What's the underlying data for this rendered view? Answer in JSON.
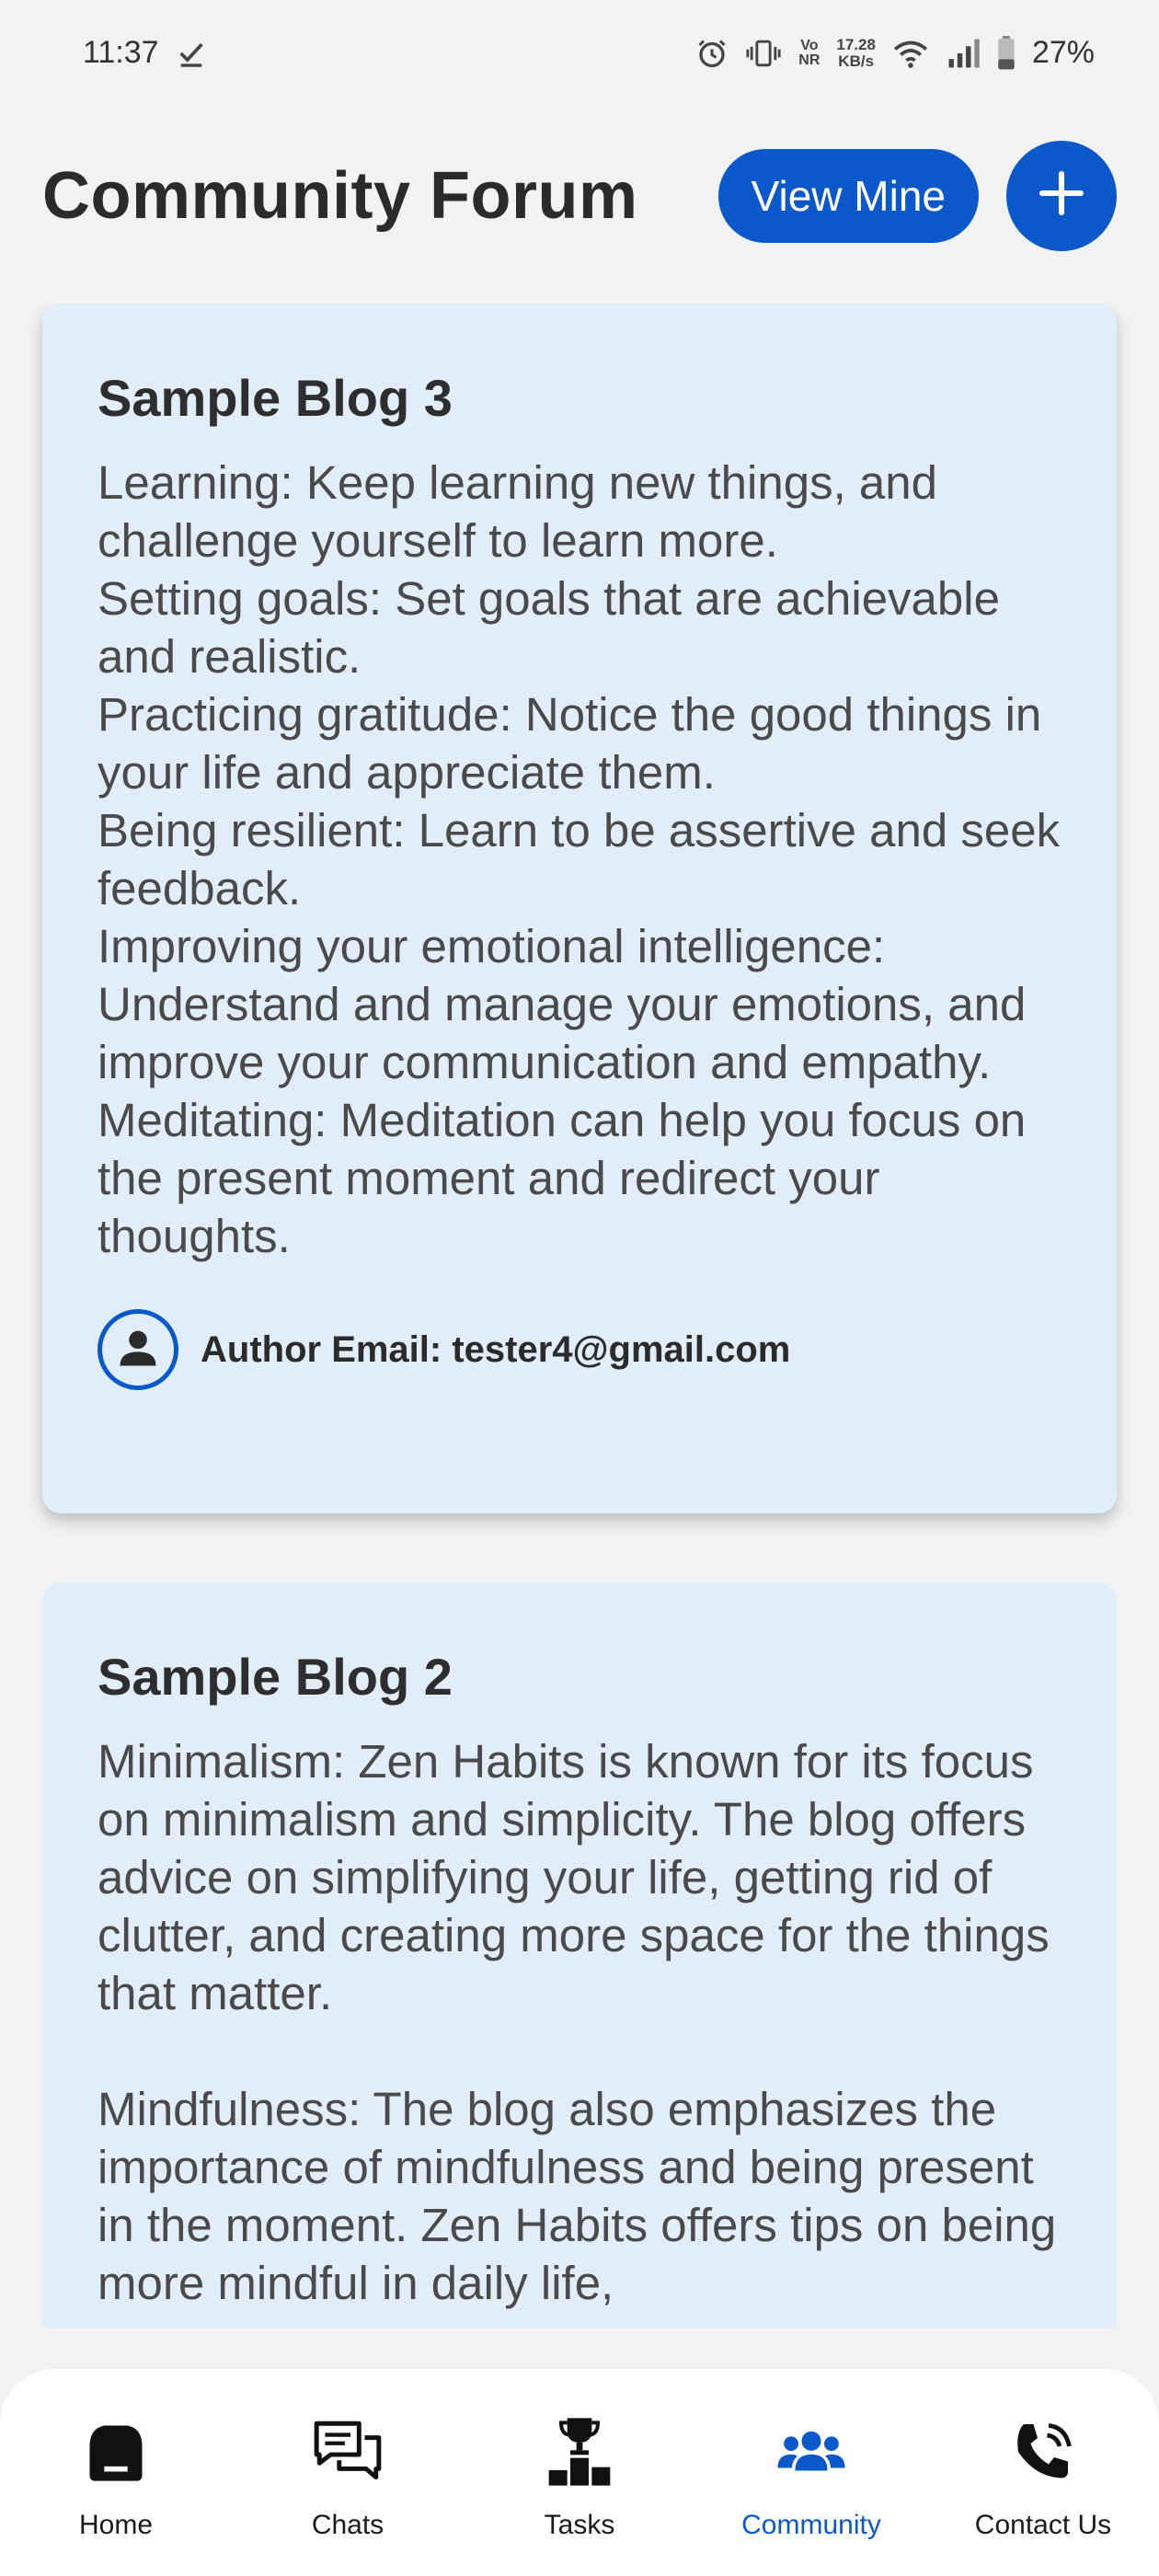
{
  "status_bar": {
    "time": "11:37",
    "network_top": "Vo",
    "network_bottom": "NR",
    "speed_top": "17.28",
    "speed_bottom": "KB/s",
    "battery": "27%"
  },
  "header": {
    "title": "Community Forum",
    "view_mine_label": "View Mine"
  },
  "posts": [
    {
      "title": "Sample Blog 3",
      "body": "Learning: Keep learning new things, and challenge yourself to learn more.\nSetting goals: Set goals that are achievable and realistic.\nPracticing gratitude: Notice the good things in your life and appreciate them.\nBeing resilient: Learn to be assertive and seek feedback.\nImproving your emotional intelligence: Understand and manage your emotions, and improve your communication and empathy.\nMeditating: Meditation can help you focus on the present moment and redirect your thoughts.",
      "author": "Author Email: tester4@gmail.com"
    },
    {
      "title": "Sample Blog 2",
      "body": "Minimalism: Zen Habits is known for its focus on minimalism and simplicity. The blog offers advice on simplifying your life, getting rid of clutter, and creating more space for the things that matter.\n\nMindfulness: The blog also emphasizes the importance of mindfulness and being present in the moment. Zen Habits offers tips on being more mindful in daily life,"
    }
  ],
  "bottom_nav": {
    "items": [
      {
        "label": "Home",
        "icon": "home-icon"
      },
      {
        "label": "Chats",
        "icon": "chat-icon"
      },
      {
        "label": "Tasks",
        "icon": "trophy-podium-icon"
      },
      {
        "label": "Community",
        "icon": "group-icon",
        "active": true
      },
      {
        "label": "Contact Us",
        "icon": "phone-icon"
      }
    ]
  },
  "colors": {
    "accent": "#0a58ca",
    "card_background": "#e1eefa",
    "page_background": "#f2f2f2"
  }
}
